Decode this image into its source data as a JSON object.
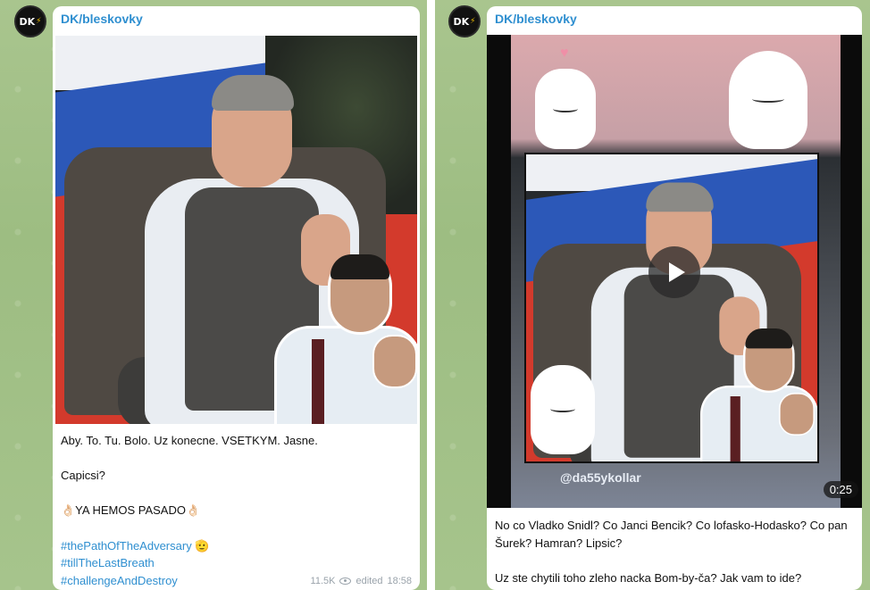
{
  "left_post": {
    "channel": "DK/bleskovky",
    "avatar_text": "DK",
    "lines": [
      "Aby. To. Tu. Bolo. Uz konecne. VSETKYM. Jasne.",
      "Capicsi?",
      "👌🏻YA HEMOS PASADO👌🏻"
    ],
    "hashtags": [
      "#thePathOfTheAdversary 🫡",
      "#tillTheLastBreath",
      "#challengeAndDestroy"
    ],
    "views": "11.5K",
    "edited_label": "edited",
    "time": "18:58"
  },
  "right_post": {
    "channel": "DK/bleskovky",
    "avatar_text": "DK",
    "watermark": "@da55ykollar",
    "duration": "0:25",
    "lines": [
      "No co Vladko Snidl? Co Janci Bencik? Co lofasko-Hodasko? Co pan Šurek? Hamran? Lipsic?",
      "Uz ste chytili toho zleho nacka Bom-by-ča? Jak vam to ide?"
    ]
  },
  "colors": {
    "chat_bg": "#a6c48c",
    "link": "#2f8fd0",
    "meta": "#9aa3ab"
  }
}
